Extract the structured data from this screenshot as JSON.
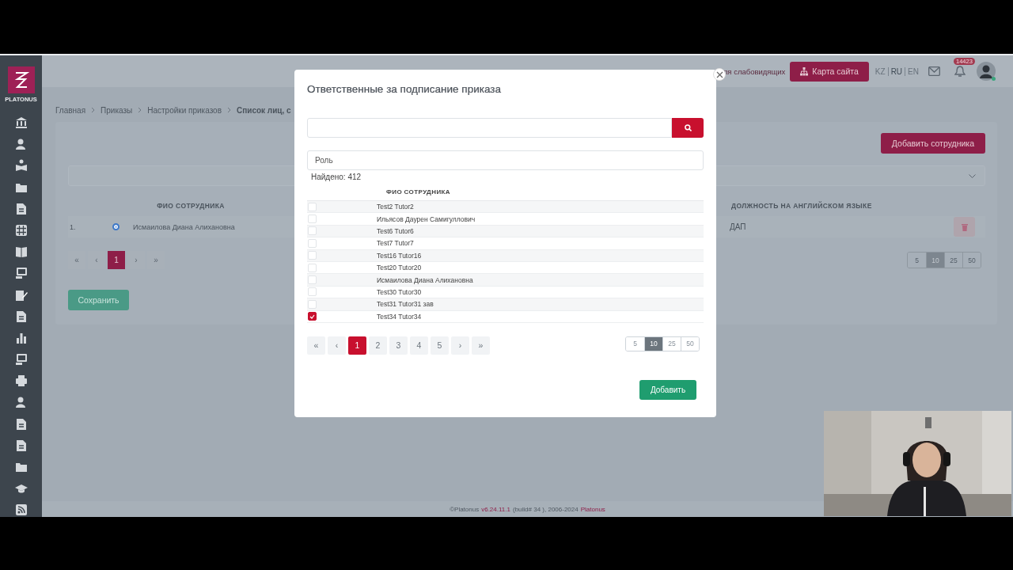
{
  "sidebar": {
    "logo_text": "PLATONUS"
  },
  "header": {
    "accessibility_link": "ля слабовидящих",
    "sitemap_button": "Карта сайта",
    "languages": [
      {
        "label": "KZ",
        "selected": false
      },
      {
        "label": "RU",
        "selected": true
      },
      {
        "label": "EN",
        "selected": false
      }
    ],
    "notifications_badge": "14423"
  },
  "breadcrumbs": [
    {
      "label": "Главная",
      "current": false
    },
    {
      "label": "Приказы",
      "current": false
    },
    {
      "label": "Настройки приказов",
      "current": false
    },
    {
      "label": "Список лиц, с",
      "current": true
    }
  ],
  "page": {
    "add_button": "Добавить сотрудника",
    "columns": [
      "ФИО СОТРУДНИКА",
      "ДОЛЖНОСТЬ НА АНГЛИЙСКОМ ЯЗЫКЕ"
    ],
    "rows": [
      {
        "number": "1.",
        "selected": true,
        "name": "Исмаилова Диана Алихановна",
        "position_en": "ДАП"
      }
    ],
    "pagination": {
      "first": "«",
      "prev": "‹",
      "pages": [
        {
          "label": "1",
          "selected": true
        }
      ],
      "next": "›",
      "last": "»"
    },
    "page_sizes": [
      {
        "label": "5",
        "selected": false
      },
      {
        "label": "10",
        "selected": true
      },
      {
        "label": "25",
        "selected": false
      },
      {
        "label": "50",
        "selected": false
      }
    ],
    "save_button": "Сохранить"
  },
  "modal": {
    "title": "Ответственные за подписание приказа",
    "role_placeholder": "Роль",
    "found": "Найдено: 412",
    "column": "ФИО СОТРУДНИКА",
    "rows": [
      {
        "name": "Test2 Tutor2",
        "checked": false
      },
      {
        "name": "Ильясов Даурен Самигуллович",
        "checked": false
      },
      {
        "name": "Test6 Tutor6",
        "checked": false
      },
      {
        "name": "Test7 Tutor7",
        "checked": false
      },
      {
        "name": "Test16 Tutor16",
        "checked": false
      },
      {
        "name": "Test20 Tutor20",
        "checked": false
      },
      {
        "name": "Исмаилова Диана Алихановна",
        "checked": false
      },
      {
        "name": "Test30 Tutor30",
        "checked": false
      },
      {
        "name": "Test31 Tutor31 зав",
        "checked": false
      },
      {
        "name": "Test34 Tutor34",
        "checked": true
      }
    ],
    "pagination": {
      "first": "«",
      "prev": "‹",
      "pages": [
        {
          "label": "1",
          "selected": true
        },
        {
          "label": "2",
          "selected": false
        },
        {
          "label": "3",
          "selected": false
        },
        {
          "label": "4",
          "selected": false
        },
        {
          "label": "5",
          "selected": false
        }
      ],
      "next": "›",
      "last": "»"
    },
    "page_sizes": [
      {
        "label": "5",
        "selected": false
      },
      {
        "label": "10",
        "selected": true
      },
      {
        "label": "25",
        "selected": false
      },
      {
        "label": "50",
        "selected": false
      }
    ],
    "add_button": "Добавить"
  },
  "footer": {
    "copyright": "©Platonus",
    "version": "v6.24.11.1",
    "build": "(build# 34 ), 2006-2024",
    "brand": "Platonus"
  }
}
